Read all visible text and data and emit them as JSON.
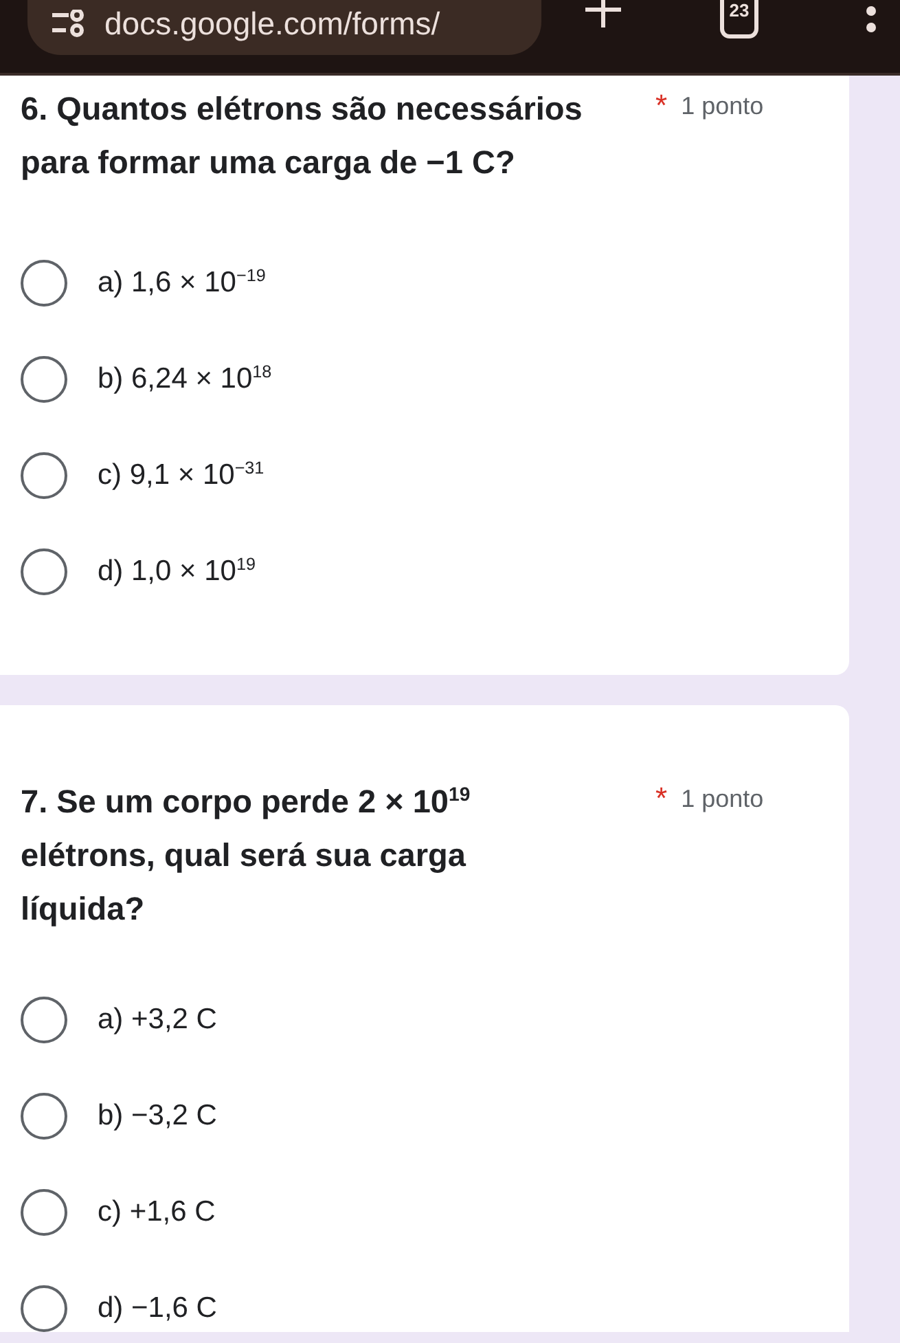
{
  "browser": {
    "url": "docs.google.com/forms/",
    "tab_count": "23"
  },
  "questions": [
    {
      "title": "6. Quantos elétrons são necessários para formar uma carga de −1 C?",
      "required_mark": "*",
      "points": "1 ponto",
      "options": [
        {
          "label": "a) 1,6 × 10$^{−19}$",
          "selected": false
        },
        {
          "label": "b) 6,24 × 10$^{18}$",
          "selected": false
        },
        {
          "label": "c) 9,1 × 10$^{−31}$",
          "selected": false
        },
        {
          "label": "d) 1,0 × 10$^{19}$",
          "selected": false
        }
      ]
    },
    {
      "title": "7. Se um corpo perde 2 × 10$^{19}$ elétrons, qual será sua carga líquida?",
      "required_mark": "*",
      "points": "1 ponto",
      "options": [
        {
          "label": "a) +3,2 C",
          "selected": false
        },
        {
          "label": "b) −3,2 C",
          "selected": false
        },
        {
          "label": "c) +1,6 C",
          "selected": false
        },
        {
          "label": "d) −1,6 C",
          "selected": false
        }
      ]
    }
  ]
}
